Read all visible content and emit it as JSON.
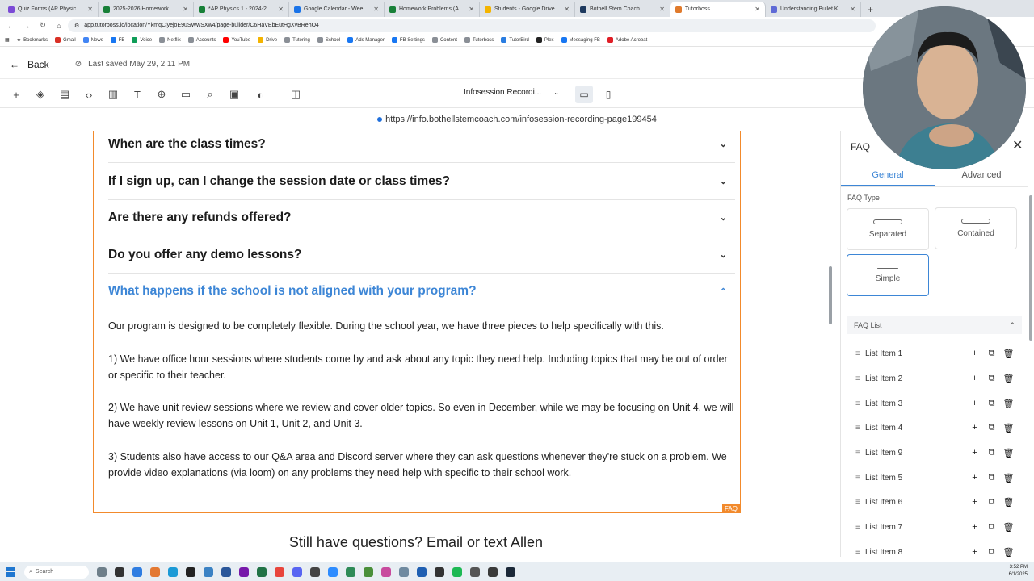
{
  "browser": {
    "tabs": [
      {
        "label": "Quiz Forms (AP Physics 1) - Go",
        "color": "#7b4ad6"
      },
      {
        "label": "2025-2026 Homework Submiss",
        "color": "#188038"
      },
      {
        "label": "*AP Physics 1 - 2024-2025 Tra",
        "color": "#188038"
      },
      {
        "label": "Google Calendar - Week of Jun",
        "color": "#1a73e8"
      },
      {
        "label": "Homework Problems (AP Calc",
        "color": "#188038"
      },
      {
        "label": "Students - Google Drive",
        "color": "#f4b400"
      },
      {
        "label": "Bothell Stem Coach",
        "color": "#1e3a5f"
      },
      {
        "label": "Tutorboss",
        "color": "#e07a2c"
      },
      {
        "label": "Understanding Bullet Kinetics",
        "color": "#5f6ad6"
      }
    ],
    "active_tab_index": 7,
    "url": "app.tutorboss.io/location/YkmqCiyejoE9uSWwSXw4/page-builder/C6HaVEbEutHgXvBRehO4",
    "bookmarks": [
      "Bookmarks",
      "Gmail",
      "News",
      "FB",
      "Voice",
      "Netflix",
      "Accounts",
      "YouTube",
      "Drive",
      "Tutoring",
      "School",
      "Ads Manager",
      "FB Settings",
      "Content",
      "Tutorboss",
      "TutorBird",
      "Plex",
      "Messaging FB",
      "Adobe Acrobat"
    ],
    "bookmarks_right": "Bookmarks"
  },
  "builder": {
    "back_label": "Back",
    "saved_label": "Last saved May 29, 2:11 PM",
    "page_select": "Infosession Recordi...",
    "published_url": "https://info.bothellstemcoach.com/infosession-recording-page199454"
  },
  "faq": {
    "questions": [
      {
        "q": "When are the class times?"
      },
      {
        "q": "If I sign up, can I change the session date or class times?"
      },
      {
        "q": "Are there any refunds offered?"
      },
      {
        "q": "Do you offer any demo lessons?"
      },
      {
        "q": "What happens if the school is not aligned with your program?"
      }
    ],
    "answer_paragraphs": [
      "Our program is designed to be completely flexible. During the school year, we have three pieces to help specifically with this.",
      "1) We have office hour sessions where students come by and ask about any topic they need help. Including topics that may be out of order or specific to their teacher.",
      "2) We have unit review sessions where we review and cover older topics. So even in December, while we may be focusing on Unit 4, we will have weekly review lessons on Unit 1, Unit 2, and Unit 3.",
      "3) Students also have access to our Q&A area and Discord server where they can ask questions whenever they're stuck on a problem. We provide video explanations (via loom) on any problems they need help with specific to their school work."
    ],
    "tag": "FAQ",
    "still_questions": "Still have questions? Email or text Allen",
    "accent": "#3d86d6",
    "outline": "#f28a2c"
  },
  "panel": {
    "title": "FAQ",
    "tabs": [
      "General",
      "Advanced"
    ],
    "faq_type_label": "FAQ Type",
    "types": [
      "Separated",
      "Contained",
      "Simple"
    ],
    "selected_type": "Simple",
    "list_header": "FAQ List",
    "items": [
      "List Item 1",
      "List Item 2",
      "List Item 3",
      "List Item 4",
      "List Item 9",
      "List Item 5",
      "List Item 6",
      "List Item 7",
      "List Item 8"
    ]
  },
  "taskbar": {
    "search_label": "Search",
    "time": "3:52 PM",
    "date": "6/1/2025"
  }
}
